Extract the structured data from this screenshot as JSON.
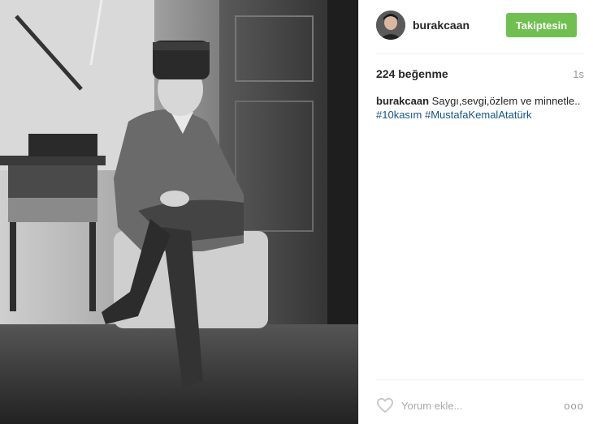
{
  "post": {
    "username": "burakcaan",
    "follow_label": "Takiptesin",
    "likes": "224 beğenme",
    "time": "1s",
    "caption_user": "burakcaan",
    "caption_text": "Saygı,sevgi,özlem ve minnetle..",
    "hashtags": [
      "#10kasım",
      "#MustafaKemalAtatürk"
    ],
    "comment_placeholder": "Yorum ekle...",
    "more_label": "ooo"
  },
  "colors": {
    "follow_button": "#70c050",
    "hashtag": "#125688",
    "muted": "#999999"
  },
  "icons": {
    "like": "heart-outline-icon",
    "more": "more-options-icon",
    "avatar": "avatar"
  }
}
